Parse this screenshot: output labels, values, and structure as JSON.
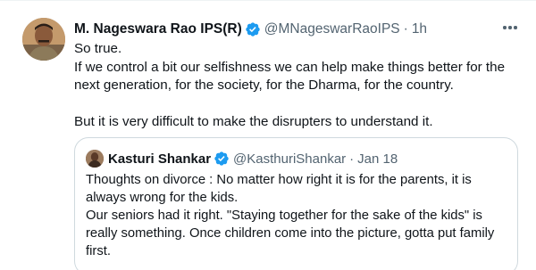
{
  "tweet": {
    "author": {
      "display_name": "M. Nageswara Rao IPS(R)",
      "handle": "@MNageswarRaoIPS",
      "separator": "·",
      "time": "1h",
      "verified": true,
      "avatar_icon": "user-avatar"
    },
    "more_icon": "more-options-icon",
    "text_lines": [
      "So true.",
      "If we control a bit our selfishness we can help make things better for the next generation, for the society, for the Dharma, for the country.",
      "But it is very difficult to make the disrupters to understand it."
    ]
  },
  "quoted_tweet": {
    "author": {
      "display_name": "Kasturi Shankar",
      "handle": "@KasthuriShankar",
      "separator": "·",
      "time": "Jan 18",
      "verified": true,
      "avatar_icon": "user-avatar"
    },
    "text_lines": [
      "Thoughts on divorce : No matter how right it is for the parents, it is always wrong for the kids.",
      "Our seniors had it right. \"Staying together for the sake of the kids\" is really something. Once children come into the picture, gotta put family first."
    ]
  },
  "colors": {
    "text_primary": "#0f1419",
    "text_secondary": "#536471",
    "verified_blue": "#1d9bf0",
    "border": "#cfd9de"
  }
}
